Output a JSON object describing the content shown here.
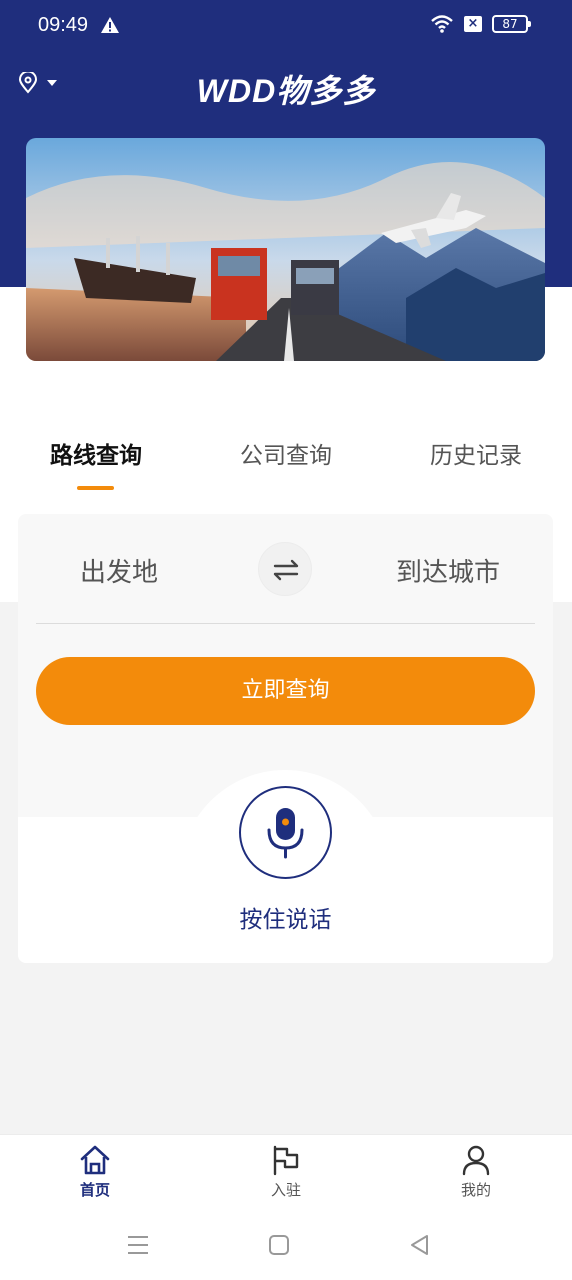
{
  "status_bar": {
    "time": "09:49",
    "battery": "87"
  },
  "header": {
    "logo_text": "WDD物多多"
  },
  "tabs": [
    {
      "label": "路线查询",
      "active": true
    },
    {
      "label": "公司查询",
      "active": false
    },
    {
      "label": "历史记录",
      "active": false
    }
  ],
  "search": {
    "origin_placeholder": "出发地",
    "destination_placeholder": "到达城市",
    "query_button": "立即查询"
  },
  "voice": {
    "label": "按住说话"
  },
  "bottom_nav": [
    {
      "label": "首页",
      "icon": "home-icon",
      "active": true
    },
    {
      "label": "入驻",
      "icon": "flag-icon",
      "active": false
    },
    {
      "label": "我的",
      "icon": "user-icon",
      "active": false
    }
  ],
  "colors": {
    "brand_blue": "#1f2e7d",
    "accent_orange": "#f38b0b"
  }
}
